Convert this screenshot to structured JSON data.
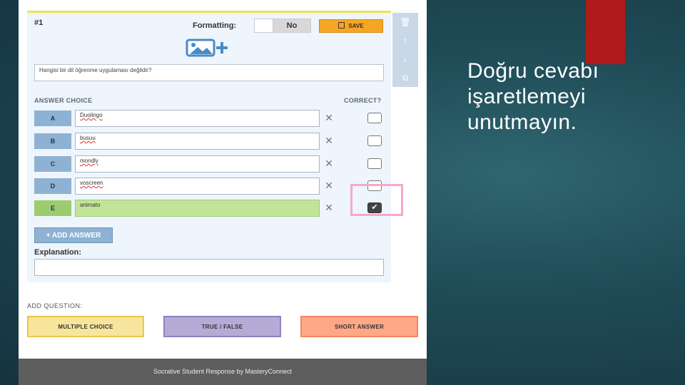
{
  "slide": {
    "text": "Doğru cevabı işaretlemeyi unutmayın."
  },
  "editor": {
    "question_number": "#1",
    "formatting_label": "Formatting:",
    "formatting_value": "No",
    "save_label": "SAVE",
    "question_text": "Hangisi bir dil öğrenme uygulaması değildir?",
    "answer_choice_header": "ANSWER CHOICE",
    "correct_header": "CORRECT?",
    "answers": [
      {
        "letter": "A",
        "text": "Duolingo",
        "correct": false
      },
      {
        "letter": "B",
        "text": "busuu",
        "correct": false
      },
      {
        "letter": "C",
        "text": "mondly",
        "correct": false
      },
      {
        "letter": "D",
        "text": "voscreen",
        "correct": false
      },
      {
        "letter": "E",
        "text": "animato",
        "correct": true
      }
    ],
    "add_answer_label": "+ ADD ANSWER",
    "explanation_label": "Explanation:",
    "explanation_value": ""
  },
  "add_question": {
    "label": "ADD QUESTION:",
    "multiple_choice": "MULTIPLE CHOICE",
    "true_false": "TRUE / FALSE",
    "short_answer": "SHORT ANSWER"
  },
  "footer": {
    "text": "Socrative Student Response by MasteryConnect"
  },
  "icons": {
    "delete": "trash-icon",
    "move_up": "arrow-up-icon",
    "move_down": "arrow-down-icon",
    "copy": "copy-icon",
    "add_image": "image-add-icon",
    "remove_answer": "close-icon",
    "save": "floppy-icon"
  },
  "colors": {
    "save_button": "#f6a623",
    "correct_row": "#c2e49a",
    "letter_badge": "#8db2d3",
    "highlight_box": "#f3a9cd",
    "accent_red": "#b01a1a"
  }
}
